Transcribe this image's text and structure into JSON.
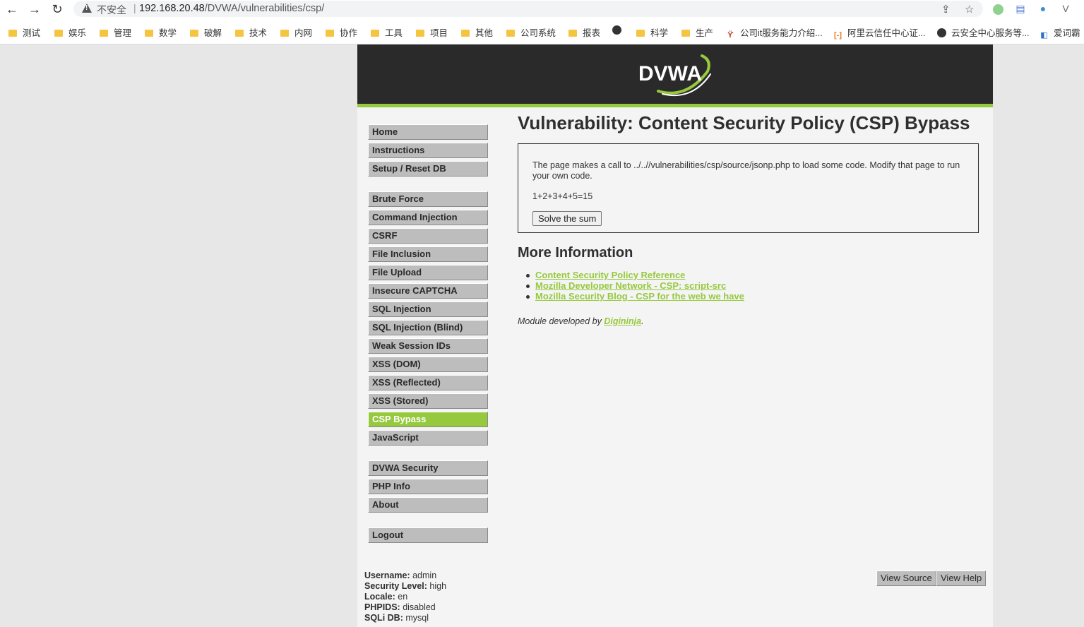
{
  "browser": {
    "insecure_label": "不安全",
    "url_host": "192.168.20.48",
    "url_path": "/DVWA/vulnerabilities/csp/",
    "bookmarks": [
      "测试",
      "娱乐",
      "管理",
      "数学",
      "破解",
      "技术",
      "内网",
      "协作",
      "工具",
      "项目",
      "其他",
      "公司系统",
      "报表",
      "科学",
      "生产",
      "公司it服务能力介绍...",
      "阿里云信任中心证...",
      "云安全中心服务等...",
      "爱词霸"
    ]
  },
  "menu": {
    "group1": [
      "Home",
      "Instructions",
      "Setup / Reset DB"
    ],
    "group2": [
      "Brute Force",
      "Command Injection",
      "CSRF",
      "File Inclusion",
      "File Upload",
      "Insecure CAPTCHA",
      "SQL Injection",
      "SQL Injection (Blind)",
      "Weak Session IDs",
      "XSS (DOM)",
      "XSS (Reflected)",
      "XSS (Stored)",
      "CSP Bypass",
      "JavaScript"
    ],
    "group3": [
      "DVWA Security",
      "PHP Info",
      "About"
    ],
    "group4": [
      "Logout"
    ],
    "selected": "CSP Bypass"
  },
  "main": {
    "title": "Vulnerability: Content Security Policy (CSP) Bypass",
    "description": "The page makes a call to ../..//vulnerabilities/csp/source/jsonp.php to load some code. Modify that page to run your own code.",
    "sum_text": "1+2+3+4+5=15",
    "solve_button": "Solve the sum",
    "more_info_heading": "More Information",
    "links": [
      "Content Security Policy Reference",
      "Mozilla Developer Network - CSP: script-src",
      "Mozilla Security Blog - CSP for the web we have"
    ],
    "credit_prefix": "Module developed by ",
    "credit_author": "Digininja",
    "credit_suffix": "."
  },
  "footer": {
    "view_source": "View Source",
    "view_help": "View Help",
    "username_label": "Username:",
    "username": "admin",
    "security_label": "Security Level:",
    "security": "high",
    "locale_label": "Locale:",
    "locale": "en",
    "phpids_label": "PHPIDS:",
    "phpids": "disabled",
    "sqli_label": "SQLi DB:",
    "sqli": "mysql"
  },
  "logo_text": "DVWA",
  "colors": {
    "accent": "#96c93d",
    "header": "#2a2a2a",
    "menu": "#bdbdbd"
  }
}
